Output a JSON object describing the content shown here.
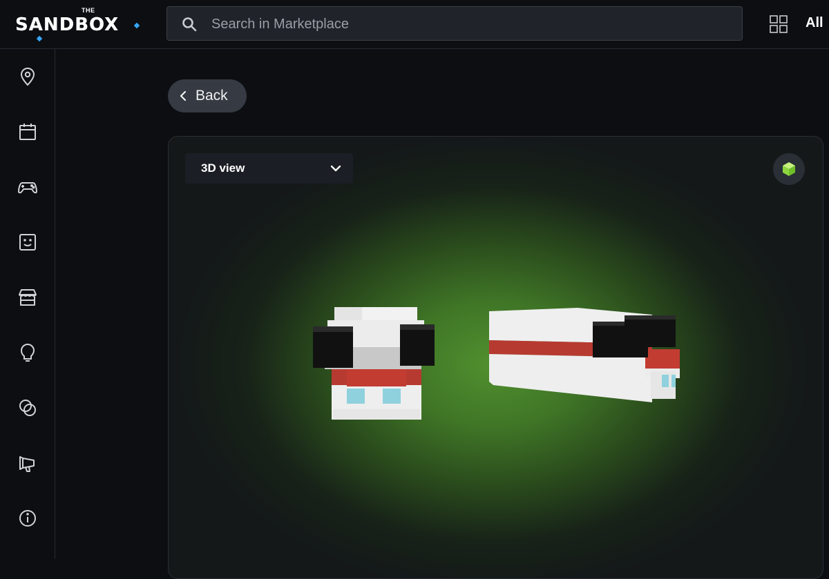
{
  "header": {
    "logo_small": "THE",
    "logo_word": "SANDBOX",
    "search_placeholder": "Search in Marketplace",
    "all_label": "All"
  },
  "sidebar": {
    "items": [
      {
        "icon": "map-pin-icon"
      },
      {
        "icon": "calendar-icon"
      },
      {
        "icon": "gamepad-icon"
      },
      {
        "icon": "smiley-face-icon"
      },
      {
        "icon": "store-icon"
      },
      {
        "icon": "lightbulb-icon"
      },
      {
        "icon": "overlapping-circles-icon"
      },
      {
        "icon": "megaphone-icon"
      },
      {
        "icon": "info-icon"
      }
    ]
  },
  "main": {
    "back_label": "Back",
    "view_mode": "3D view",
    "accent_cube_color": "#a6e85a",
    "viewer_glow_color": "#51902f"
  }
}
